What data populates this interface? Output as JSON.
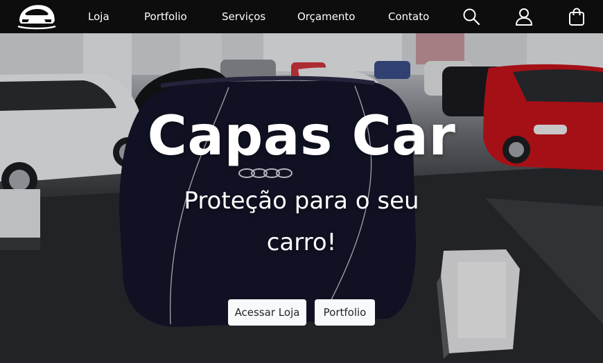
{
  "nav": {
    "logo": "car-logo",
    "items": [
      {
        "label": "Loja"
      },
      {
        "label": "Portfolio"
      },
      {
        "label": "Serviços"
      },
      {
        "label": "Orçamento"
      },
      {
        "label": "Contato"
      }
    ],
    "icons": [
      "search-icon",
      "user-icon",
      "shopping-bag-icon"
    ]
  },
  "hero": {
    "title": "Capas Car",
    "subtitle": "Proteção para o seu carro!",
    "buttons": [
      {
        "label": "Acessar Loja"
      },
      {
        "label": "Portfolio"
      }
    ]
  },
  "colors": {
    "navbar_bg": "#0d0d0d",
    "text": "#ffffff",
    "button_bg": "#f8f9fa",
    "button_text": "#212529",
    "car_red": "#c8141b",
    "car_white": "#f2f3f5",
    "car_cover": "#14152a"
  }
}
